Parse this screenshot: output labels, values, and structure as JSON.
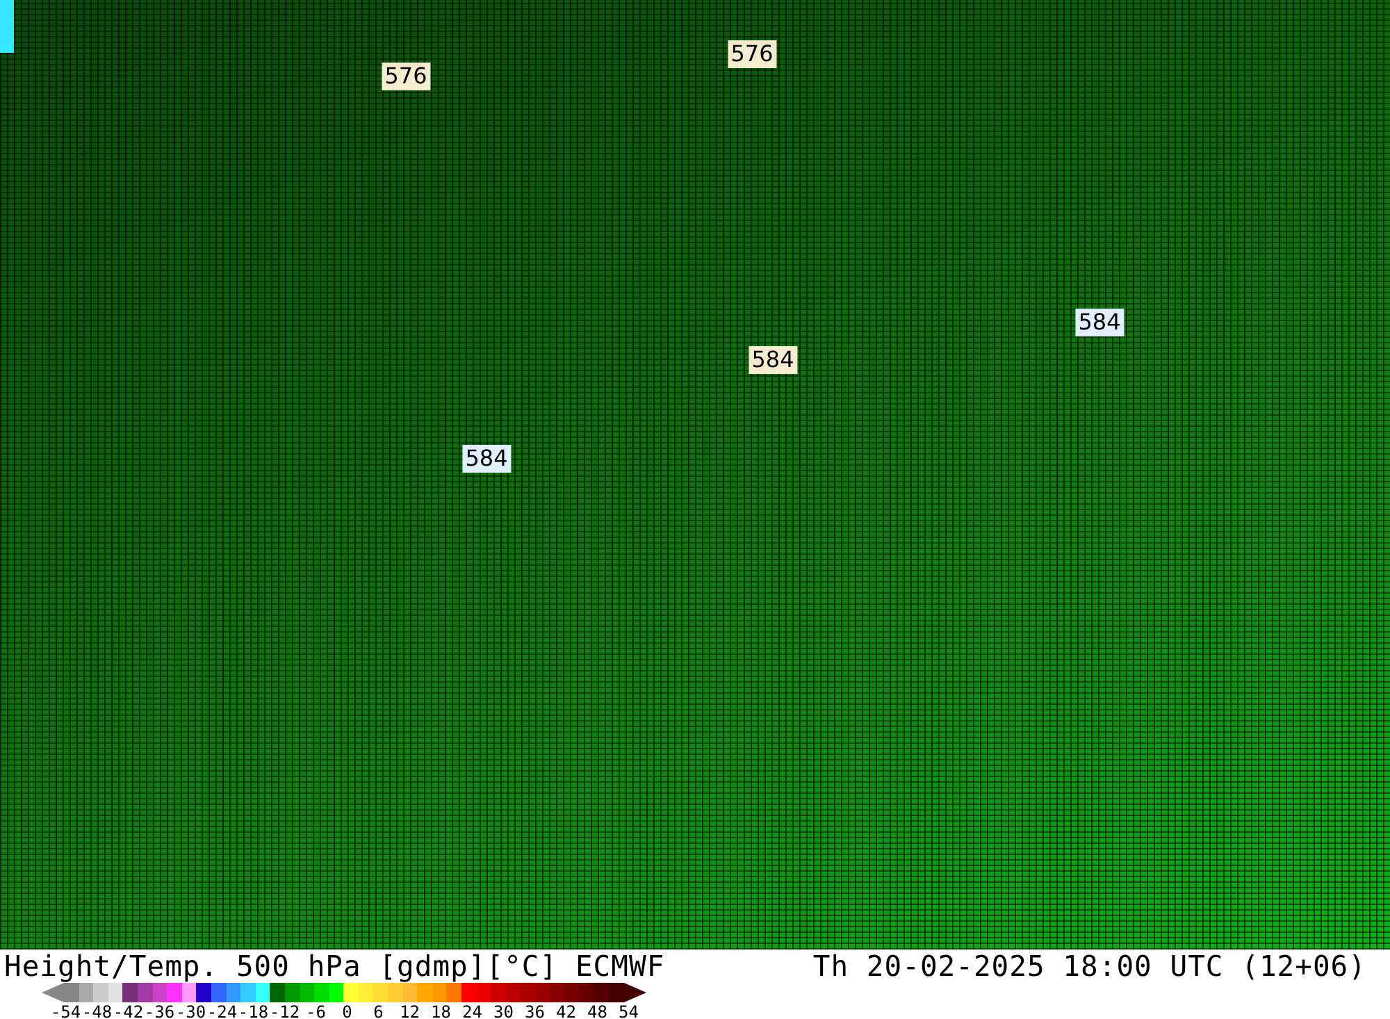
{
  "map": {
    "contour_labels": [
      {
        "text": "576",
        "color": "#f5ecd0"
      },
      {
        "text": "576",
        "color": "#f5ecd0"
      },
      {
        "text": "584",
        "color": "#e0f0ff"
      },
      {
        "text": "584",
        "color": "#f5ecd0"
      },
      {
        "text": "584",
        "color": "#e0f0ff"
      }
    ]
  },
  "footer": {
    "title": "Height/Temp. 500 hPa [gdmp][°C] ECMWF",
    "valid_time": "Th 20-02-2025 18:00 UTC (12+06)"
  },
  "legend": {
    "swatches": [
      {
        "color": "#888888"
      },
      {
        "color": "#aaaaaa"
      },
      {
        "color": "#cccccc"
      },
      {
        "color": "#e2e2e2"
      },
      {
        "color": "#78317a"
      },
      {
        "color": "#a43aa8"
      },
      {
        "color": "#cc44cc"
      },
      {
        "color": "#ff33ff"
      },
      {
        "color": "#ff99ff"
      },
      {
        "color": "#2200cc"
      },
      {
        "color": "#3366ff"
      },
      {
        "color": "#3399ff"
      },
      {
        "color": "#33ccff"
      },
      {
        "color": "#33ffff"
      },
      {
        "color": "#006600"
      },
      {
        "color": "#009900"
      },
      {
        "color": "#00bb00"
      },
      {
        "color": "#00dd00"
      },
      {
        "color": "#00ff00"
      },
      {
        "color": "#ffff33"
      },
      {
        "color": "#ffee33"
      },
      {
        "color": "#ffdd33"
      },
      {
        "color": "#ffcc33"
      },
      {
        "color": "#ffbb33"
      },
      {
        "color": "#ffaa00"
      },
      {
        "color": "#ff9900"
      },
      {
        "color": "#ff7700"
      },
      {
        "color": "#ff0000"
      },
      {
        "color": "#ee0000"
      },
      {
        "color": "#cc0000"
      },
      {
        "color": "#bb0000"
      },
      {
        "color": "#aa0000"
      },
      {
        "color": "#990000"
      },
      {
        "color": "#880000"
      },
      {
        "color": "#770000"
      },
      {
        "color": "#660000"
      },
      {
        "color": "#550000"
      },
      {
        "color": "#440000"
      }
    ],
    "ticks": [
      "-54",
      "-48",
      "-42",
      "-36",
      "-30",
      "-24",
      "-18",
      "-12",
      "-6",
      "0",
      "6",
      "12",
      "18",
      "24",
      "30",
      "36",
      "42",
      "48",
      "54"
    ]
  }
}
